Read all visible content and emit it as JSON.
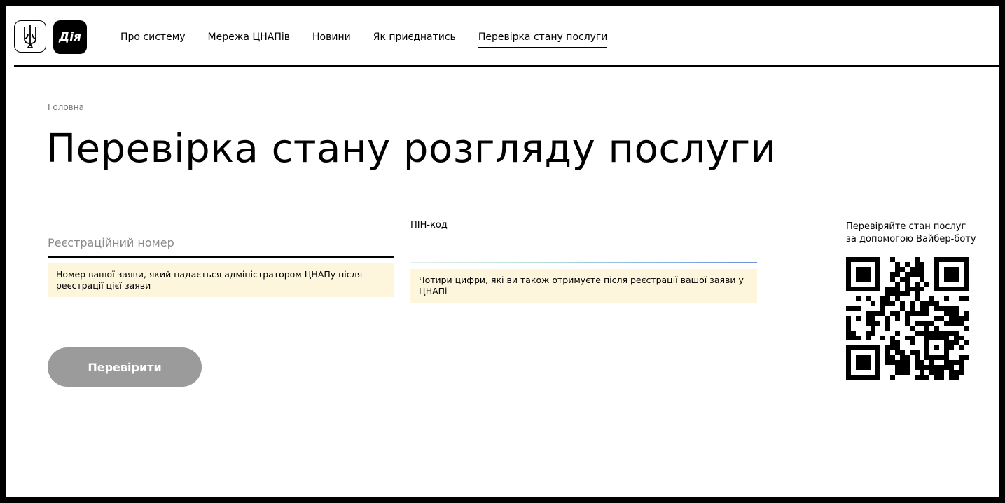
{
  "header": {
    "logo_text": "Дія",
    "nav": [
      {
        "label": "Про систему"
      },
      {
        "label": "Мережа ЦНАПів"
      },
      {
        "label": "Новини"
      },
      {
        "label": "Як приєднатись"
      },
      {
        "label": "Перевірка стану послуги",
        "active": true
      }
    ]
  },
  "breadcrumb": "Головна",
  "title": "Перевірка стану розгляду послуги",
  "form": {
    "reg_placeholder": "Реєстраційний номер",
    "reg_hint": "Номер вашої заяви, який надається адміністратором ЦНАПу після реєстрації цієї заяви",
    "pin_label": "ПІН-код",
    "pin_hint": "Чотири цифри, які ви також отримуєте після реєстрації вашої заяви у ЦНАПі",
    "submit_label": "Перевірити"
  },
  "viber": {
    "line1": "Перевіряйте стан послуг",
    "line2": "за допомогою Вайбер-боту"
  },
  "colors": {
    "button_disabled": "#9b9b9b",
    "hint_bg": "#fef6dc"
  }
}
